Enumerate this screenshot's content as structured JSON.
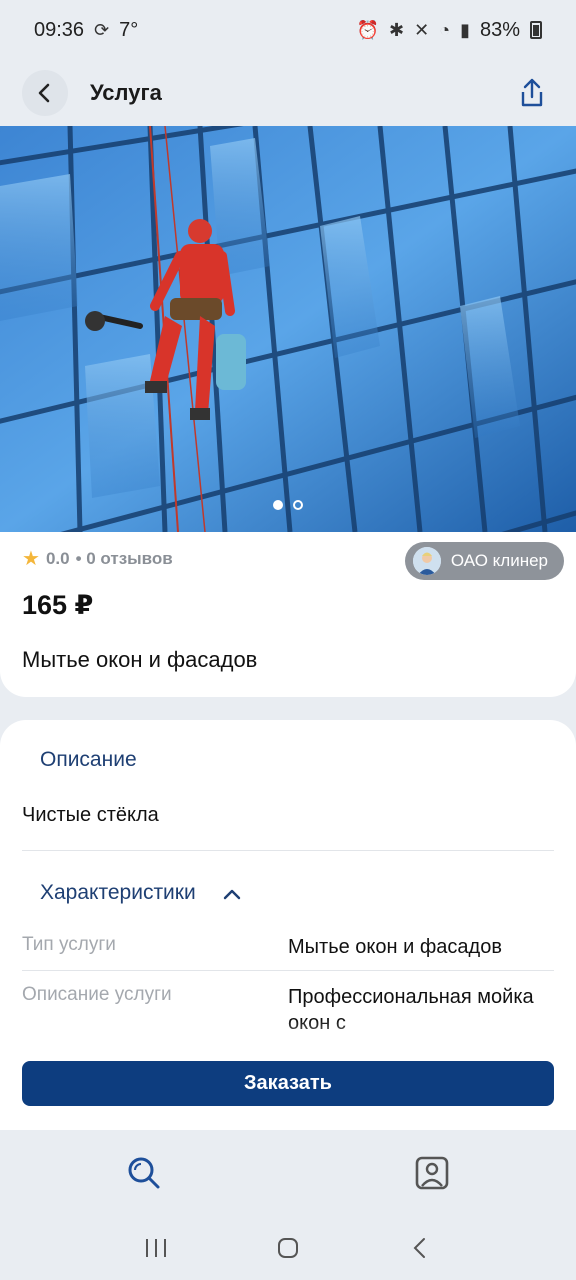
{
  "status_bar": {
    "time": "09:36",
    "temperature": "7°",
    "battery": "83%",
    "icons": [
      "alarm-icon",
      "bluetooth-icon",
      "mute-icon",
      "wifi-icon",
      "volte-icon",
      "signal-icon",
      "battery-icon"
    ]
  },
  "header": {
    "title": "Услуга",
    "back_icon": "chevron-left-icon",
    "share_icon": "share-icon"
  },
  "gallery": {
    "image": "window-cleaner-on-glass-facade",
    "total": 2,
    "active_index": 0
  },
  "summary": {
    "rating": "0.0",
    "reviews": "• 0 отзывов",
    "vendor": "ОАО клинер",
    "price": "165 ₽",
    "service_name": "Мытье окон и фасадов"
  },
  "details": {
    "description_title": "Описание",
    "description_text": "Чистые стёкла",
    "specs_title": "Характеристики",
    "specs": [
      {
        "key": "Тип услуги",
        "value": "Мытье окон и фасадов"
      },
      {
        "key": "Описание услуги",
        "value": "Профессиональная мойка окон с"
      }
    ]
  },
  "actions": {
    "order_label": "Заказать"
  },
  "bottom_nav": [
    "search-icon",
    "profile-icon"
  ],
  "colors": {
    "accent": "#0d3d7f",
    "section_title": "#1e3f73",
    "star": "#f4b63a",
    "background": "#e9edf2"
  }
}
